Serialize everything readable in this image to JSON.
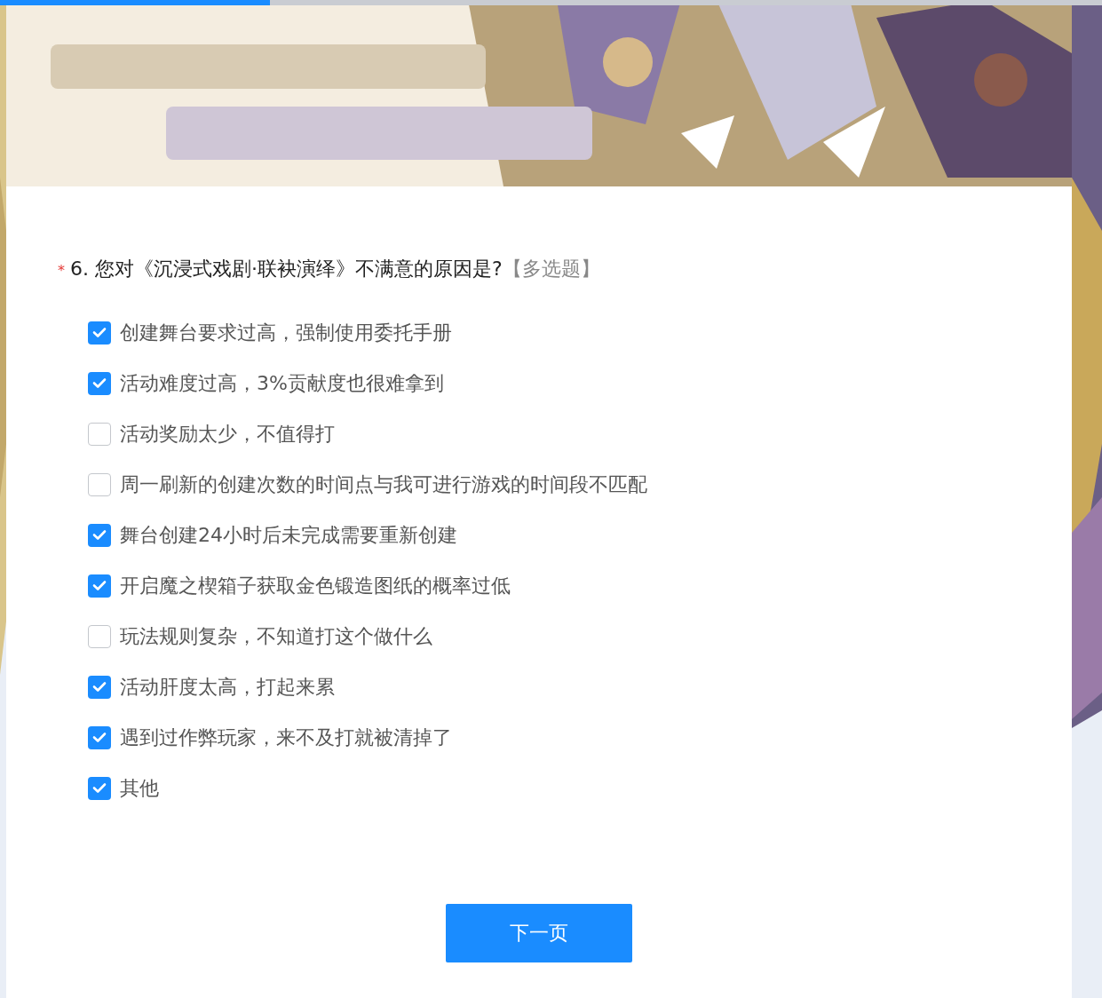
{
  "progress": {
    "level": 0.245
  },
  "question": {
    "required_mark": "*",
    "title": "6. 您对《沉浸式戏剧·联袂演绎》不满意的原因是?",
    "type_tag": "【多选题】"
  },
  "options": [
    {
      "label": "创建舞台要求过高，强制使用委托手册",
      "checked": true
    },
    {
      "label": "活动难度过高，3%贡献度也很难拿到",
      "checked": true
    },
    {
      "label": "活动奖励太少，不值得打",
      "checked": false
    },
    {
      "label": "周一刷新的创建次数的时间点与我可进行游戏的时间段不匹配",
      "checked": false
    },
    {
      "label": "舞台创建24小时后未完成需要重新创建",
      "checked": true
    },
    {
      "label": "开启魔之楔箱子获取金色锻造图纸的概率过低",
      "checked": true
    },
    {
      "label": "玩法规则复杂，不知道打这个做什么",
      "checked": false
    },
    {
      "label": "活动肝度太高，打起来累",
      "checked": true
    },
    {
      "label": "遇到过作弊玩家，来不及打就被清掉了",
      "checked": true
    },
    {
      "label": "其他",
      "checked": true
    }
  ],
  "next_button": "下一页"
}
